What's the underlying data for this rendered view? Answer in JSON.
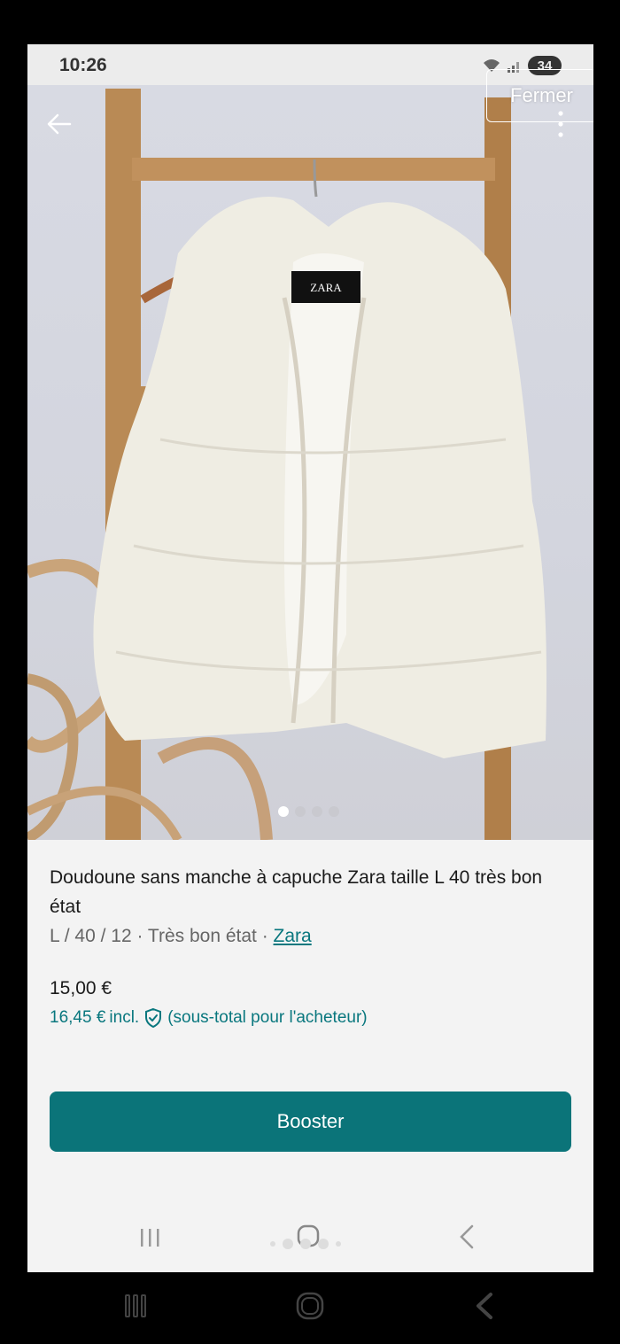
{
  "status_bar": {
    "time": "10:26",
    "battery": "34"
  },
  "toolbar": {
    "close_label": "Fermer"
  },
  "gallery": {
    "image_count": 4,
    "active_index": 0,
    "garment_label": "ZARA"
  },
  "listing": {
    "title": "Doudoune sans manche à capuche Zara taille L 40 très bon état",
    "meta_prefix": "L / 40 / 12 · Très bon état · ",
    "brand": "Zara",
    "price": "15,00 €",
    "price_incl_amount": "16,45 €",
    "price_incl_word": "incl.",
    "price_incl_note": "(sous-total pour l'acheteur)"
  },
  "actions": {
    "boost_label": "Booster"
  },
  "colors": {
    "accent": "#0b7479",
    "link": "#09777e",
    "background": "#f3f3f3"
  },
  "icons": [
    "back-arrow-icon",
    "more-vert-icon",
    "shield-check-icon",
    "recent-apps-icon",
    "home-icon",
    "back-icon"
  ]
}
